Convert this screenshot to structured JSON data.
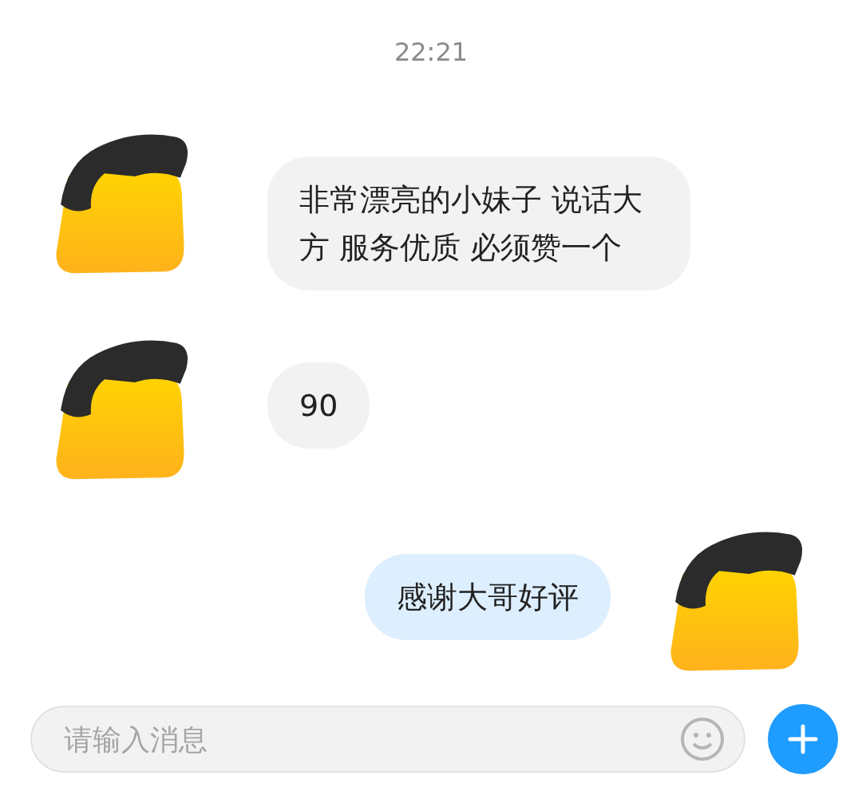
{
  "time": "22:21",
  "messages": [
    {
      "kind": "incoming",
      "text": "非常漂亮的小妹子 说话大方 服务优质 必须赞一个"
    },
    {
      "kind": "incoming",
      "text": "90"
    },
    {
      "kind": "outgoing",
      "text": "感谢大哥好评"
    }
  ],
  "composer": {
    "placeholder": "请输入消息"
  }
}
